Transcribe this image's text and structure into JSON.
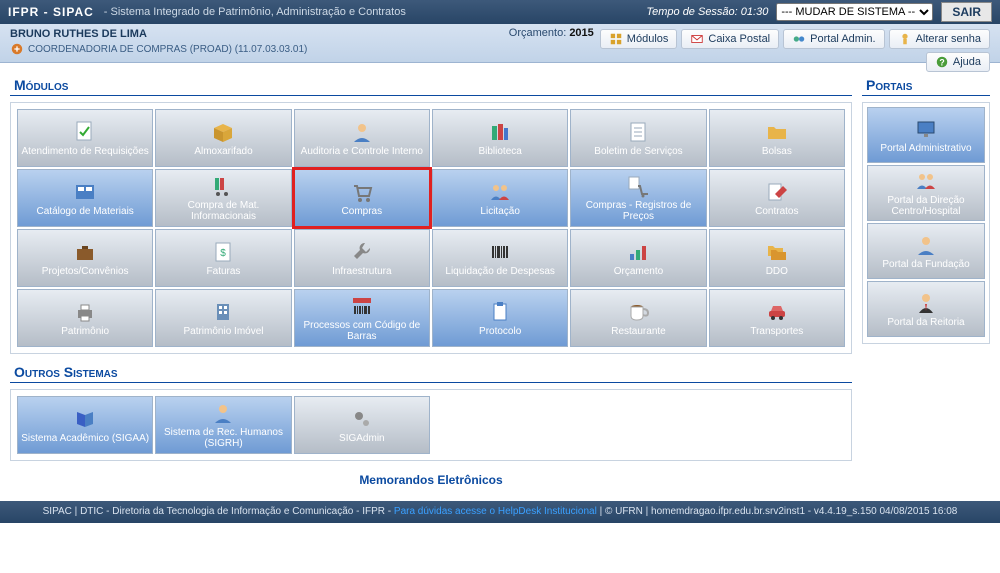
{
  "top": {
    "brand": "IFPR - SIPAC",
    "subtitle": "- Sistema Integrado de Patrimônio, Administração e Contratos",
    "session_label": "Tempo de Sessão:",
    "session_time": "01:30",
    "system_select": "--- MUDAR DE SISTEMA --",
    "sair": "SAIR"
  },
  "user": {
    "name": "BRUNO RUTHES DE LIMA",
    "dept": "COORDENADORIA DE COMPRAS (PROAD) (11.07.03.03.01)",
    "orc_label": "Orçamento:",
    "orc_year": "2015",
    "tools": {
      "modulos": "Módulos",
      "caixa": "Caixa Postal",
      "portal": "Portal Admin.",
      "alterar": "Alterar senha",
      "ajuda": "Ajuda"
    }
  },
  "sections": {
    "modulos": "Módulos",
    "outros": "Outros Sistemas",
    "portais": "Portais"
  },
  "modules": [
    {
      "label": "Atendimento de Requisições",
      "blue": false,
      "icon": "doc-check"
    },
    {
      "label": "Almoxarifado",
      "blue": false,
      "icon": "box"
    },
    {
      "label": "Auditoria e Controle Interno",
      "blue": false,
      "icon": "person"
    },
    {
      "label": "Biblioteca",
      "blue": false,
      "icon": "books"
    },
    {
      "label": "Boletim de Serviços",
      "blue": false,
      "icon": "sheet"
    },
    {
      "label": "Bolsas",
      "blue": false,
      "icon": "folder"
    },
    {
      "label": "Catálogo de Materiais",
      "blue": true,
      "icon": "catalog"
    },
    {
      "label": "Compra de Mat. Informacionais",
      "blue": false,
      "icon": "books-cart"
    },
    {
      "label": "Compras",
      "blue": true,
      "icon": "cart",
      "highlight": true
    },
    {
      "label": "Licitação",
      "blue": true,
      "icon": "people"
    },
    {
      "label": "Compras - Registros de Preços",
      "blue": true,
      "icon": "cart-doc"
    },
    {
      "label": "Contratos",
      "blue": false,
      "icon": "pen"
    },
    {
      "label": "Projetos/Convênios",
      "blue": false,
      "icon": "briefcase"
    },
    {
      "label": "Faturas",
      "blue": false,
      "icon": "invoice"
    },
    {
      "label": "Infraestrutura",
      "blue": false,
      "icon": "wrench"
    },
    {
      "label": "Liquidação de Despesas",
      "blue": false,
      "icon": "barcode"
    },
    {
      "label": "Orçamento",
      "blue": false,
      "icon": "chart"
    },
    {
      "label": "DDO",
      "blue": false,
      "icon": "folders"
    },
    {
      "label": "Patrimônio",
      "blue": false,
      "icon": "printer"
    },
    {
      "label": "Patrimônio Imóvel",
      "blue": false,
      "icon": "building"
    },
    {
      "label": "Processos com Código de Barras",
      "blue": true,
      "icon": "barcode2"
    },
    {
      "label": "Protocolo",
      "blue": true,
      "icon": "clipboard"
    },
    {
      "label": "Restaurante",
      "blue": false,
      "icon": "cup"
    },
    {
      "label": "Transportes",
      "blue": false,
      "icon": "car"
    }
  ],
  "outros": [
    {
      "label": "Sistema Acadêmico (SIGAA)",
      "blue": true,
      "icon": "book"
    },
    {
      "label": "Sistema de Rec. Humanos (SIGRH)",
      "blue": true,
      "icon": "person"
    },
    {
      "label": "SIGAdmin",
      "blue": false,
      "icon": "gears"
    }
  ],
  "portais": [
    {
      "label": "Portal Administrativo",
      "blue": true,
      "icon": "screen"
    },
    {
      "label": "Portal da Direção Centro/Hospital",
      "blue": false,
      "icon": "people"
    },
    {
      "label": "Portal da Fundação",
      "blue": false,
      "icon": "person"
    },
    {
      "label": "Portal da Reitoria",
      "blue": false,
      "icon": "person-suit"
    }
  ],
  "memo": "Memorandos Eletrônicos",
  "footer": {
    "left": "SIPAC | DTIC - Diretoria da Tecnologia de Informação e Comunicação - IFPR - ",
    "link": "Para dúvidas acesse o HelpDesk Institucional",
    "right": " | © UFRN | homemdragao.ifpr.edu.br.srv2inst1 - v4.4.19_s.150 04/08/2015 16:08"
  }
}
